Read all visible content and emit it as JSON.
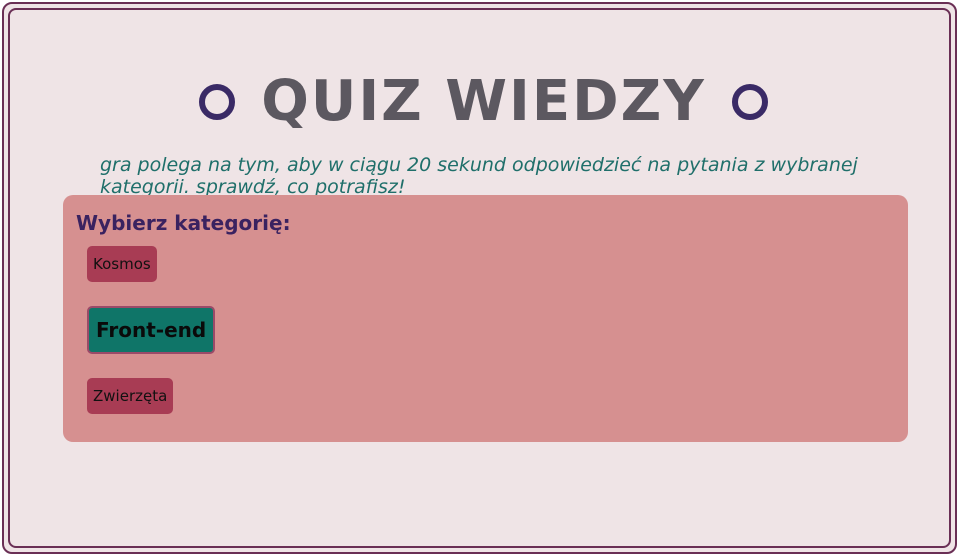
{
  "header": {
    "title": "QUIZ WIEDZY",
    "description": "gra polega na tym, aby w ciągu 20 sekund odpowiedzieć na pytania z wybranej kategorii. sprawdź, co potrafisz!"
  },
  "categories": {
    "heading": "Wybierz kategorię:",
    "items": [
      {
        "label": "Kosmos"
      },
      {
        "label": "Front-end",
        "state": "hovered"
      },
      {
        "label": "Zwierzęta"
      }
    ]
  },
  "colors": {
    "background": "#efe4e6",
    "frame": "#6a2f55",
    "panel": "#d69090",
    "button": "#a83c54",
    "button_active": "#0f7568",
    "title": "#5c5860",
    "description": "#1f6f6a",
    "heading": "#3a2260",
    "ring": "#3a2a66"
  },
  "icons": {
    "left": "ring-icon",
    "right": "ring-icon"
  }
}
